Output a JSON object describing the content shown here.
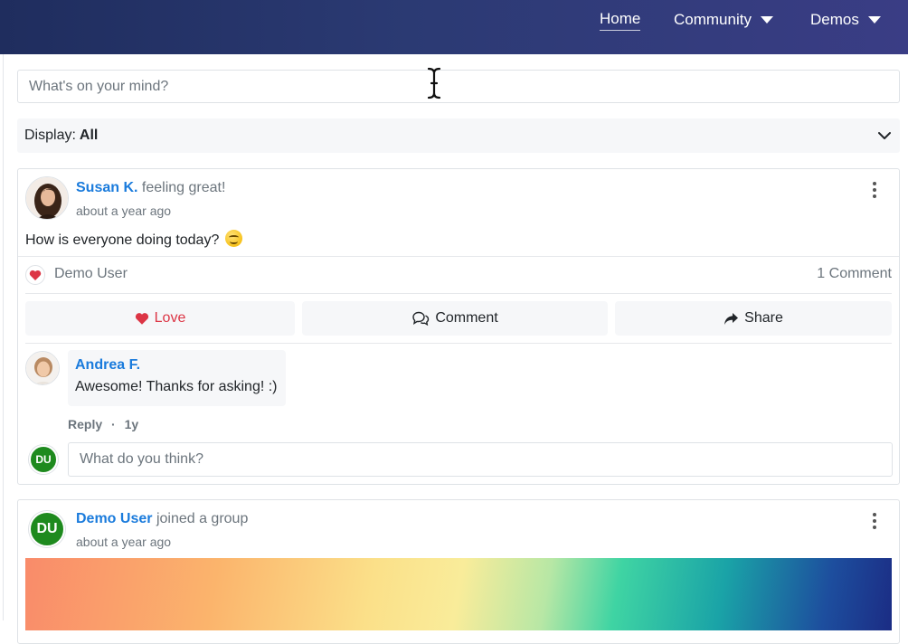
{
  "nav": {
    "items": [
      {
        "label": "Home",
        "active": true
      },
      {
        "label": "Community",
        "dropdown": true
      },
      {
        "label": "Demos",
        "dropdown": true
      }
    ]
  },
  "composer": {
    "placeholder": "What's on your mind?"
  },
  "display_filter": {
    "label": "Display:",
    "value": "All"
  },
  "posts": [
    {
      "author": "Susan K.",
      "action": "feeling great!",
      "time": "about a year ago",
      "body": "How is everyone doing today?",
      "emoji": "smiling-face-icon",
      "reactions": {
        "who": "Demo User",
        "comments": "1 Comment"
      },
      "actions": {
        "love": "Love",
        "comment": "Comment",
        "share": "Share"
      },
      "comments": [
        {
          "author": "Andrea F.",
          "text": "Awesome! Thanks for asking! :)",
          "reply": "Reply",
          "separator": "·",
          "age": "1y"
        }
      ],
      "comment_input": {
        "placeholder": "What do you think?",
        "avatar_initials": "DU"
      }
    },
    {
      "author": "Demo User",
      "action": "joined a group",
      "time": "about a year ago",
      "avatar_initials": "DU"
    }
  ],
  "colors": {
    "link": "#1a7bdc",
    "love": "#dc3545",
    "avatar_green": "#1e8a1e",
    "navbar_start": "#1f2d5e",
    "navbar_end": "#3a3d85"
  }
}
